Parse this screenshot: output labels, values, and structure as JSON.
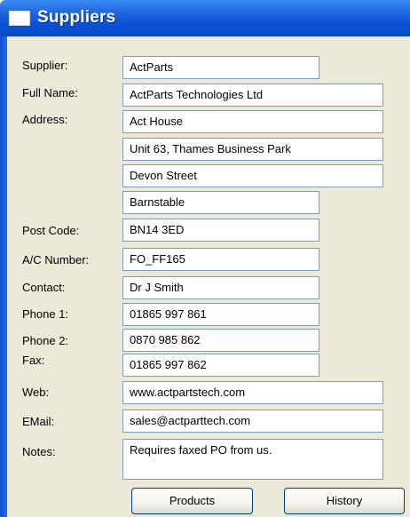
{
  "window": {
    "title": "Suppliers"
  },
  "form": {
    "supplier": {
      "label": "Supplier:",
      "value": "ActParts"
    },
    "full_name": {
      "label": "Full Name:",
      "value": "ActParts Technologies Ltd"
    },
    "address": {
      "label": "Address:",
      "lines": [
        "Act House",
        "Unit 63, Thames Business Park",
        "Devon Street",
        "Barnstable"
      ]
    },
    "post_code": {
      "label": "Post Code:",
      "value": "BN14 3ED"
    },
    "ac_number": {
      "label": "A/C Number:",
      "value": "FO_FF165"
    },
    "contact": {
      "label": "Contact:",
      "value": "Dr J Smith"
    },
    "phone1": {
      "label": "Phone 1:",
      "value": "01865 997 861"
    },
    "phone2": {
      "label": "Phone 2:",
      "value": "0870 985 862"
    },
    "fax": {
      "label": "Fax:",
      "value": "01865 997 862"
    },
    "web": {
      "label": "Web:",
      "value": "www.actpartstech.com"
    },
    "email": {
      "label": "EMail:",
      "value": "sales@actparttech.com"
    },
    "notes": {
      "label": "Notes:",
      "value": "Requires faxed PO from us."
    }
  },
  "buttons": {
    "products": "Products",
    "history": "History"
  }
}
